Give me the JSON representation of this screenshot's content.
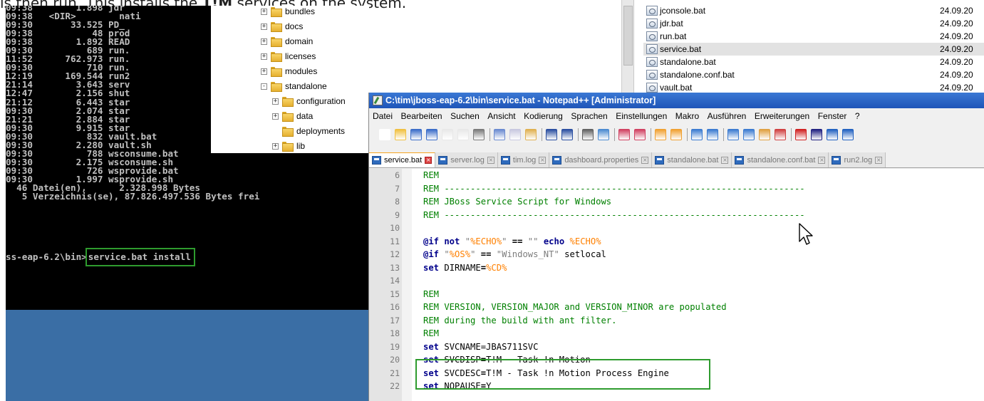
{
  "caption": {
    "prefix": "is then run. This installs the ",
    "bold": "T!M",
    "suffix": " services on the system."
  },
  "console": {
    "lines": [
      "09:38        1.898 jdr",
      "09:38   <DIR>        nati",
      "09:30       33.525 PD_",
      "09:38           48 prod",
      "09:38        1.892 READ",
      "09:30          689 run.",
      "11:52      762.973 run.",
      "09:30          710 run.",
      "12:19      169.544 run2",
      "21:14        3.643 serv",
      "12:47        2.156 shut",
      "21:12        6.443 star",
      "09:30        2.074 star",
      "21:21        2.884 star",
      "09:30        9.915 star",
      "09:30          832 vault.bat",
      "09:30        2.280 vault.sh",
      "09:30          788 wsconsume.bat",
      "09:30        2.175 wsconsume.sh",
      "09:30          726 wsprovide.bat",
      "09:30        1.997 wsprovide.sh",
      "  46 Datei(en),      2.328.998 Bytes",
      "   5 Verzeichnis(se), 87.826.497.536 Bytes frei"
    ],
    "prompt": "ss-eap-6.2\\bin>",
    "command": "service.bat install"
  },
  "tree": {
    "items": [
      {
        "label": "bundles",
        "expander": "+"
      },
      {
        "label": "docs",
        "expander": "+"
      },
      {
        "label": "domain",
        "expander": "+"
      },
      {
        "label": "licenses",
        "expander": "+"
      },
      {
        "label": "modules",
        "expander": "+"
      },
      {
        "label": "standalone",
        "expander": "-"
      },
      {
        "label": "configuration",
        "expander": "+"
      },
      {
        "label": "data",
        "expander": "+"
      },
      {
        "label": "deployments",
        "expander": ""
      },
      {
        "label": "lib",
        "expander": "+"
      }
    ]
  },
  "filelist": {
    "rows": [
      {
        "name": "jconsole.bat",
        "date": "24.09.20"
      },
      {
        "name": "jdr.bat",
        "date": "24.09.20"
      },
      {
        "name": "run.bat",
        "date": "24.09.20"
      },
      {
        "name": "service.bat",
        "date": "24.09.20",
        "selected": true
      },
      {
        "name": "standalone.bat",
        "date": "24.09.20"
      },
      {
        "name": "standalone.conf.bat",
        "date": "24.09.20"
      },
      {
        "name": "vault.bat",
        "date": "24.09.20"
      }
    ]
  },
  "notepad": {
    "title": "C:\\tim\\jboss-eap-6.2\\bin\\service.bat - Notepad++ [Administrator]",
    "menu": [
      "Datei",
      "Bearbeiten",
      "Suchen",
      "Ansicht",
      "Kodierung",
      "Sprachen",
      "Einstellungen",
      "Makro",
      "Ausführen",
      "Erweiterungen",
      "Fenster",
      "?"
    ],
    "tabs": [
      {
        "label": "service.bat",
        "active": true
      },
      {
        "label": "server.log"
      },
      {
        "label": "tim.log"
      },
      {
        "label": "dashboard.properties"
      },
      {
        "label": "standalone.bat"
      },
      {
        "label": "standalone.conf.bat"
      },
      {
        "label": "run2.log"
      }
    ],
    "line_numbers": [
      "6",
      "7",
      "8",
      "9",
      "10",
      "11",
      "12",
      "13",
      "14",
      "15",
      "16",
      "17",
      "18",
      "19",
      "20",
      "21",
      "22"
    ],
    "code": {
      "l6": "REM",
      "l7": "REM ---------------------------------------------------------------------",
      "l8": "REM JBoss Service Script for Windows",
      "l9": "REM ---------------------------------------------------------------------",
      "l11_kw": "@if not",
      "l11_s1": "\"",
      "l11_v1": "%ECHO%",
      "l11_s2": "\"",
      "l11_op": " == ",
      "l11_s3": "\"\"",
      "l11_kw2": " echo ",
      "l11_v2": "%ECHO%",
      "l12_kw": "@if",
      "l12_s1": " \"",
      "l12_v1": "%OS%",
      "l12_s2": "\"",
      "l12_op": " == ",
      "l12_s3": "\"Windows_NT\"",
      "l12_id": " setlocal",
      "l13_kw": "set",
      "l13_id": " DIRNAME",
      "l13_op": "=",
      "l13_v": "%CD%",
      "l15": "REM",
      "l16": "REM VERSION, VERSION_MAJOR and VERSION_MINOR are populated",
      "l17": "REM during the build with ant filter.",
      "l18": "REM",
      "l19_kw": "set",
      "l19_rest": " SVCNAME=JBAS711SVC",
      "l20_kw": "set",
      "l20_id": " SVCDISP",
      "l20_op": "=",
      "l20_val": "T!M - Task !n Motion",
      "l21_kw": "set",
      "l21_id": " SVCDESC",
      "l21_op": "=",
      "l21_val": "T!M - Task !n Motion Process Engine",
      "l22_kw": "set",
      "l22_id": " NOPAUSE",
      "l22_op": "=",
      "l22_val": "Y"
    }
  },
  "colors": {
    "highlight_box": "#2e9b2e",
    "rem_comment": "#008000",
    "keyword": "#00008b",
    "variable": "#ff8000",
    "desktop": "#3a6ea5"
  }
}
